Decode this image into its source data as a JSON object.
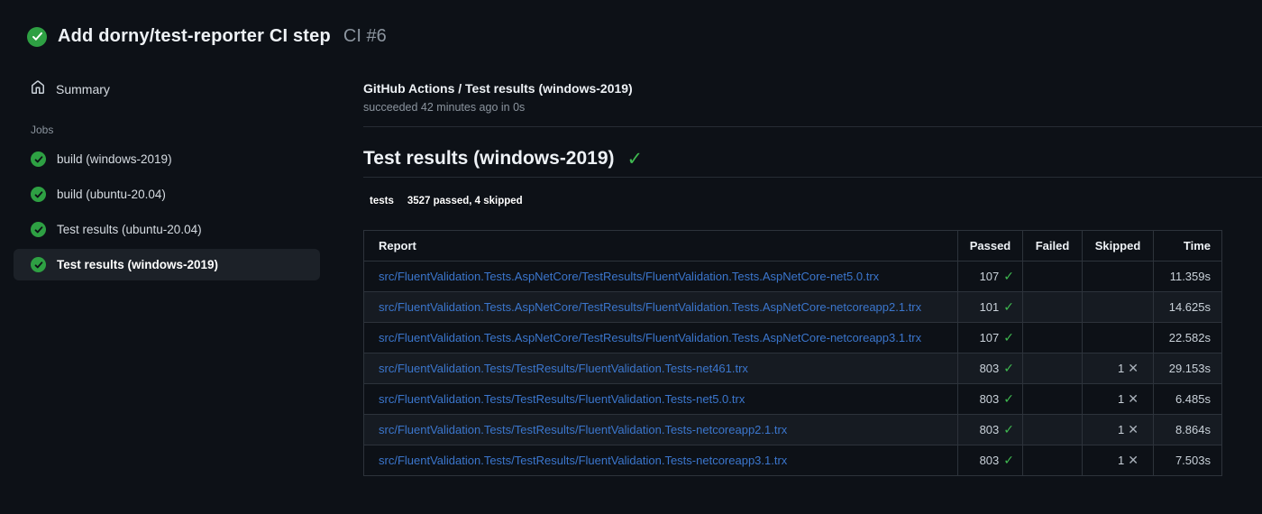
{
  "colors": {
    "background": "#0d1117",
    "selected_item_bg": "#1c2128",
    "success_green": "#2ea043",
    "bright_check_green": "#3fb950",
    "link_blue": "#3b76cd",
    "badge_label_bg": "#555555",
    "badge_value_bg": "#44cc11",
    "muted_text": "#8b949e"
  },
  "icons": {
    "check_glyph": "✓",
    "cross_glyph": "✕"
  },
  "header": {
    "title": "Add dorny/test-reporter CI step",
    "run_number": "CI #6"
  },
  "sidebar": {
    "summary_label": "Summary",
    "jobs_label": "Jobs",
    "jobs": [
      {
        "label": "build (windows-2019)",
        "selected": false
      },
      {
        "label": "build (ubuntu-20.04)",
        "selected": false
      },
      {
        "label": "Test results (ubuntu-20.04)",
        "selected": false
      },
      {
        "label": "Test results (windows-2019)",
        "selected": true
      }
    ]
  },
  "main": {
    "check_title": "GitHub Actions / Test results (windows-2019)",
    "check_status": "succeeded 42 minutes ago in 0s",
    "section_title": "Test results (windows-2019)",
    "badge": {
      "label": "tests",
      "value": "3527 passed, 4 skipped"
    },
    "table": {
      "headers": {
        "report": "Report",
        "passed": "Passed",
        "failed": "Failed",
        "skipped": "Skipped",
        "time": "Time"
      },
      "rows": [
        {
          "report": "src/FluentValidation.Tests.AspNetCore/TestResults/FluentValidation.Tests.AspNetCore-net5.0.trx",
          "passed": "107",
          "failed": "",
          "skipped": "",
          "time": "11.359s"
        },
        {
          "report": "src/FluentValidation.Tests.AspNetCore/TestResults/FluentValidation.Tests.AspNetCore-netcoreapp2.1.trx",
          "passed": "101",
          "failed": "",
          "skipped": "",
          "time": "14.625s"
        },
        {
          "report": "src/FluentValidation.Tests.AspNetCore/TestResults/FluentValidation.Tests.AspNetCore-netcoreapp3.1.trx",
          "passed": "107",
          "failed": "",
          "skipped": "",
          "time": "22.582s"
        },
        {
          "report": "src/FluentValidation.Tests/TestResults/FluentValidation.Tests-net461.trx",
          "passed": "803",
          "failed": "",
          "skipped": "1",
          "time": "29.153s"
        },
        {
          "report": "src/FluentValidation.Tests/TestResults/FluentValidation.Tests-net5.0.trx",
          "passed": "803",
          "failed": "",
          "skipped": "1",
          "time": "6.485s"
        },
        {
          "report": "src/FluentValidation.Tests/TestResults/FluentValidation.Tests-netcoreapp2.1.trx",
          "passed": "803",
          "failed": "",
          "skipped": "1",
          "time": "8.864s"
        },
        {
          "report": "src/FluentValidation.Tests/TestResults/FluentValidation.Tests-netcoreapp3.1.trx",
          "passed": "803",
          "failed": "",
          "skipped": "1",
          "time": "7.503s"
        }
      ]
    }
  }
}
